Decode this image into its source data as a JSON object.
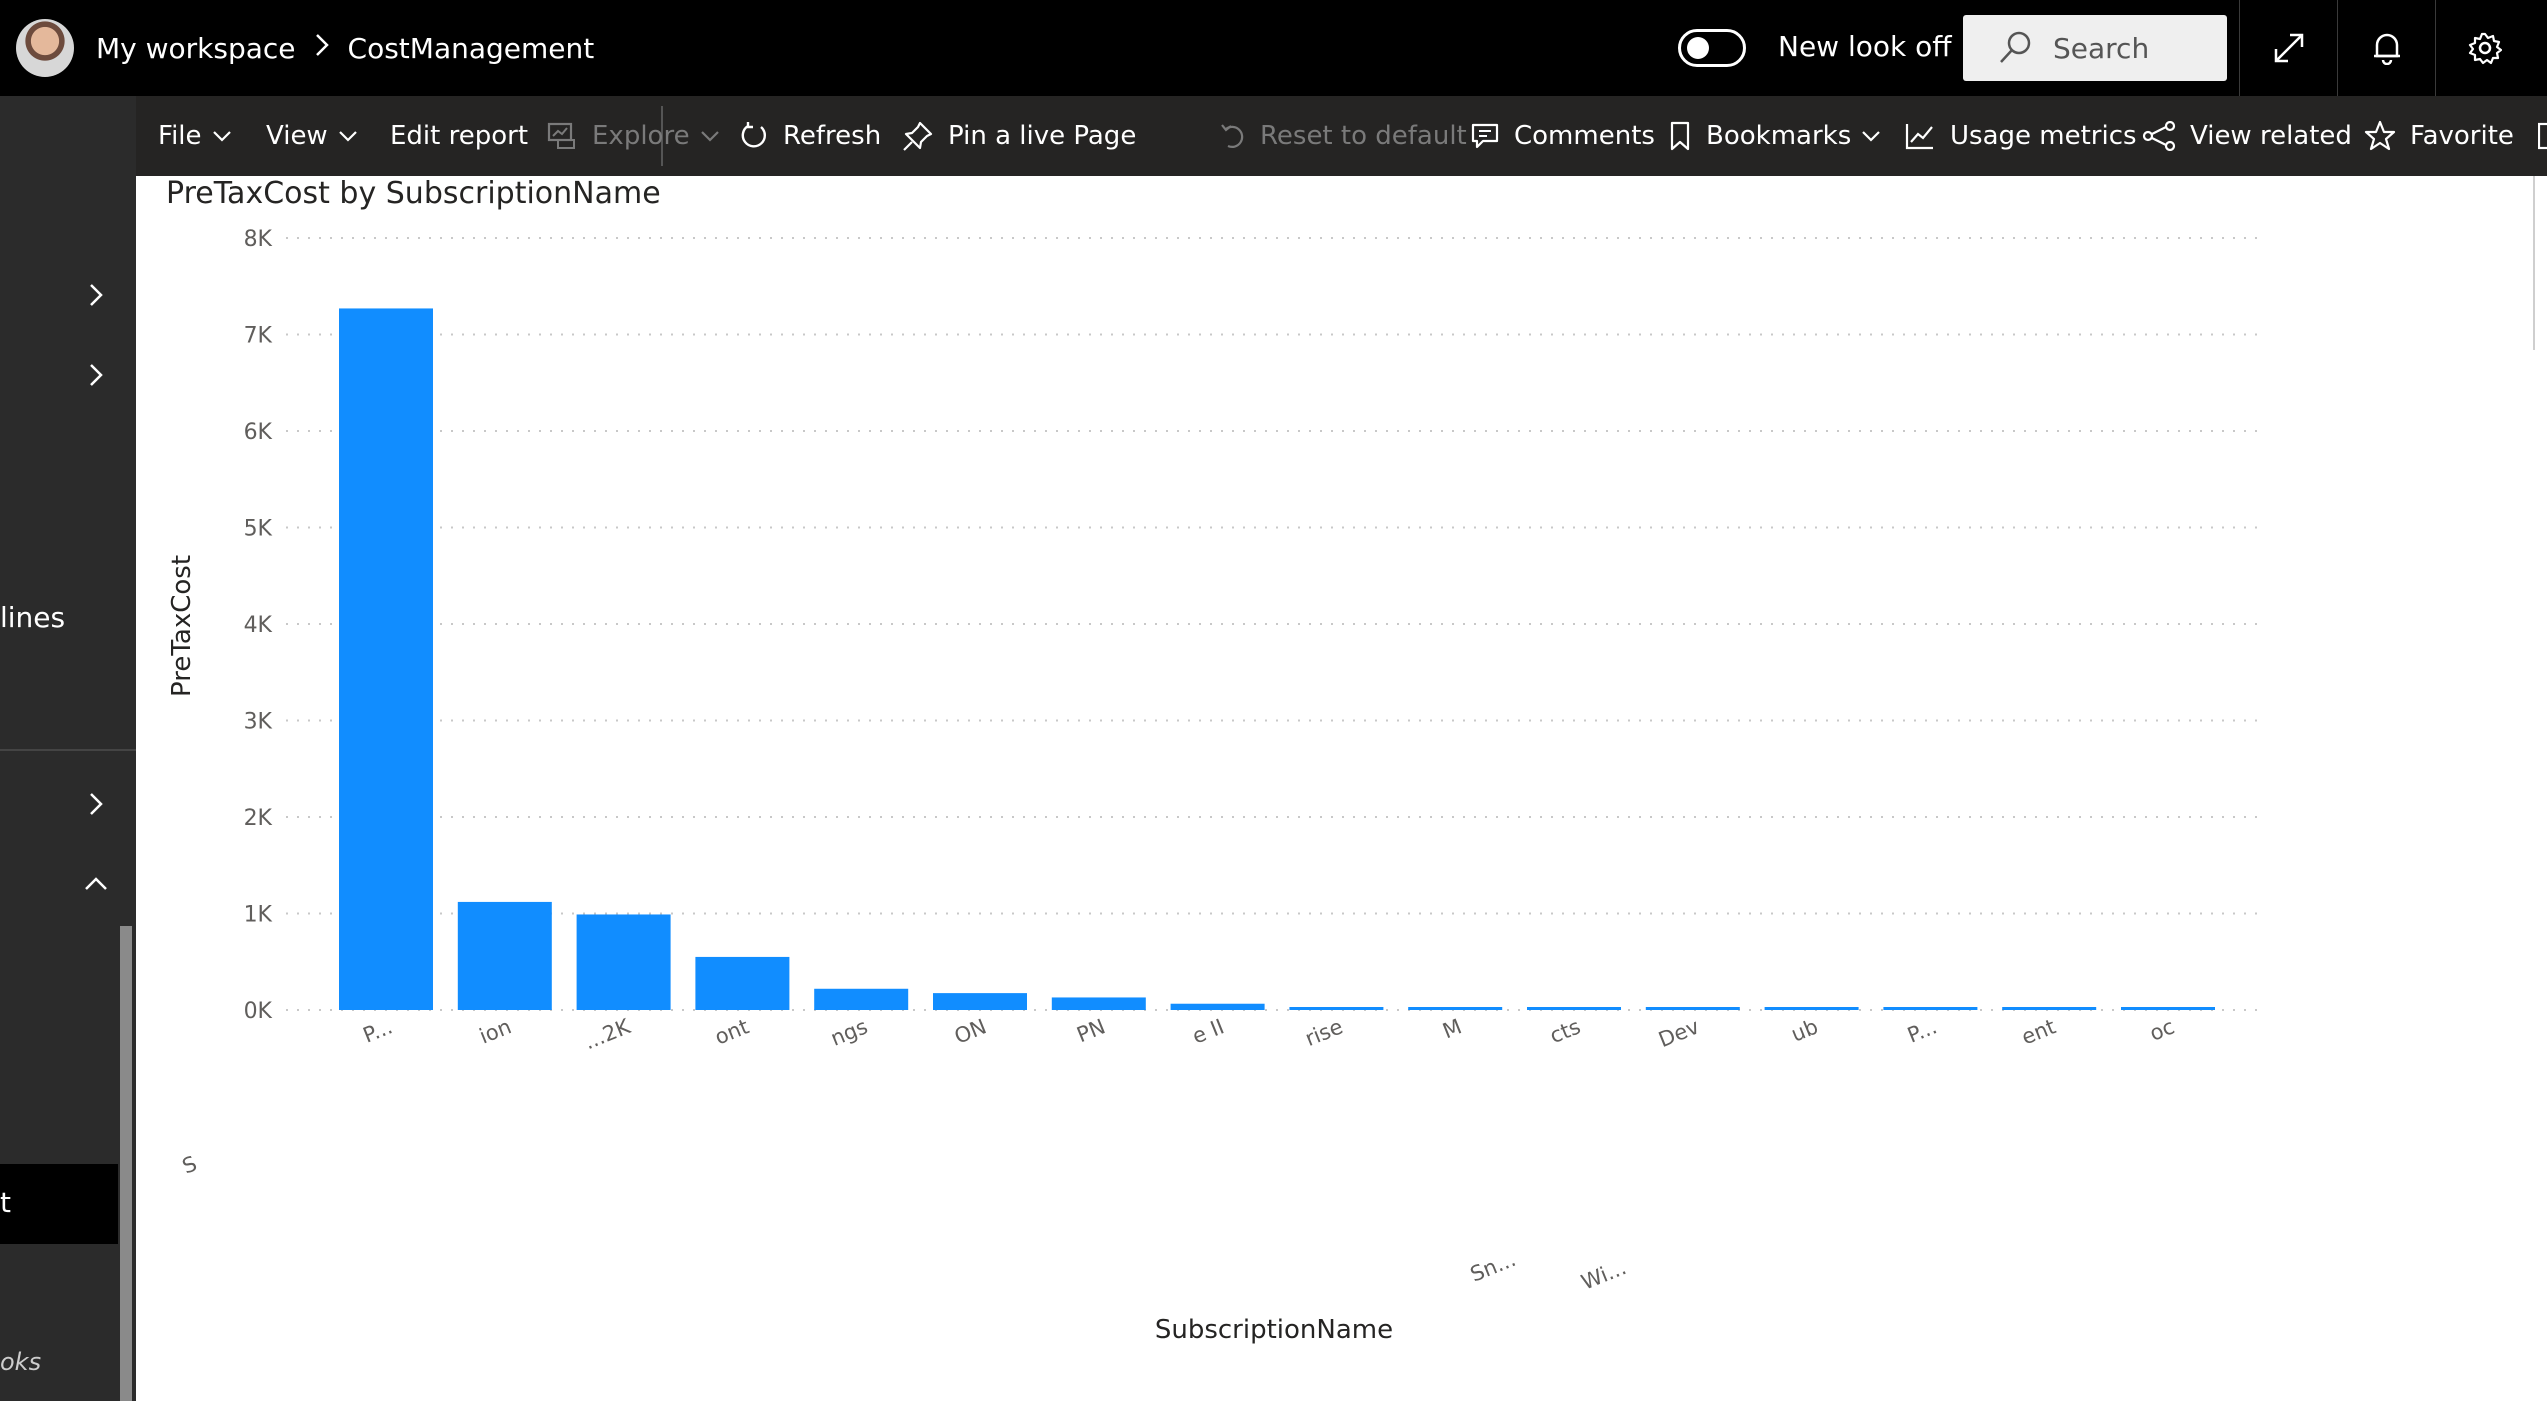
{
  "header": {
    "workspace": "My workspace",
    "report_name": "CostManagement",
    "toggle_label": "New look off",
    "search_placeholder": "Search"
  },
  "leftnav": {
    "partial_labels": [
      "lines",
      "t",
      "oks"
    ]
  },
  "toolbar": {
    "items": [
      {
        "label": "File",
        "icon": "none",
        "dropdown": true
      },
      {
        "label": "View",
        "icon": "none",
        "dropdown": true
      },
      {
        "label": "Edit report",
        "icon": "none",
        "dropdown": false
      },
      {
        "label": "Explore",
        "icon": "explore-icon",
        "dropdown": true,
        "disabled": true
      },
      {
        "label": "Refresh",
        "icon": "refresh-icon",
        "dropdown": false
      },
      {
        "label": "Pin a live Page",
        "icon": "pin-icon",
        "dropdown": false
      },
      {
        "label": "Reset to default",
        "icon": "reset-icon",
        "dropdown": false,
        "disabled": true
      },
      {
        "label": "Comments",
        "icon": "comment-icon",
        "dropdown": false
      },
      {
        "label": "Bookmarks",
        "icon": "bookmark-icon",
        "dropdown": true
      },
      {
        "label": "Usage metrics",
        "icon": "usage-icon",
        "dropdown": false
      },
      {
        "label": "View related",
        "icon": "related-icon",
        "dropdown": false
      },
      {
        "label": "Favorite",
        "icon": "star-icon",
        "dropdown": false
      }
    ]
  },
  "colors": {
    "bar": "#118DFF",
    "gridline": "#c8c8c8",
    "axis_text": "#605e5c"
  },
  "chart_data": {
    "type": "bar",
    "title": "PreTaxCost by SubscriptionName",
    "xlabel": "SubscriptionName",
    "ylabel": "PreTaxCost",
    "ylim": [
      0,
      8000
    ],
    "yticks": [
      "0K",
      "1K",
      "2K",
      "3K",
      "4K",
      "5K",
      "6K",
      "7K",
      "8K"
    ],
    "grid": true,
    "categories": [
      "P...",
      "ion",
      "...2K",
      "ont",
      "ngs",
      "ON",
      "PN",
      "e II",
      "rise",
      "M",
      "cts",
      "Dev",
      "ub",
      "P...",
      "ent",
      "oc"
    ],
    "values": [
      7270,
      1120,
      990,
      550,
      220,
      175,
      130,
      65,
      18,
      15,
      13,
      11,
      10,
      9,
      8,
      7
    ],
    "stray_labels": [
      "S",
      "Sn...",
      "Wi..."
    ]
  }
}
